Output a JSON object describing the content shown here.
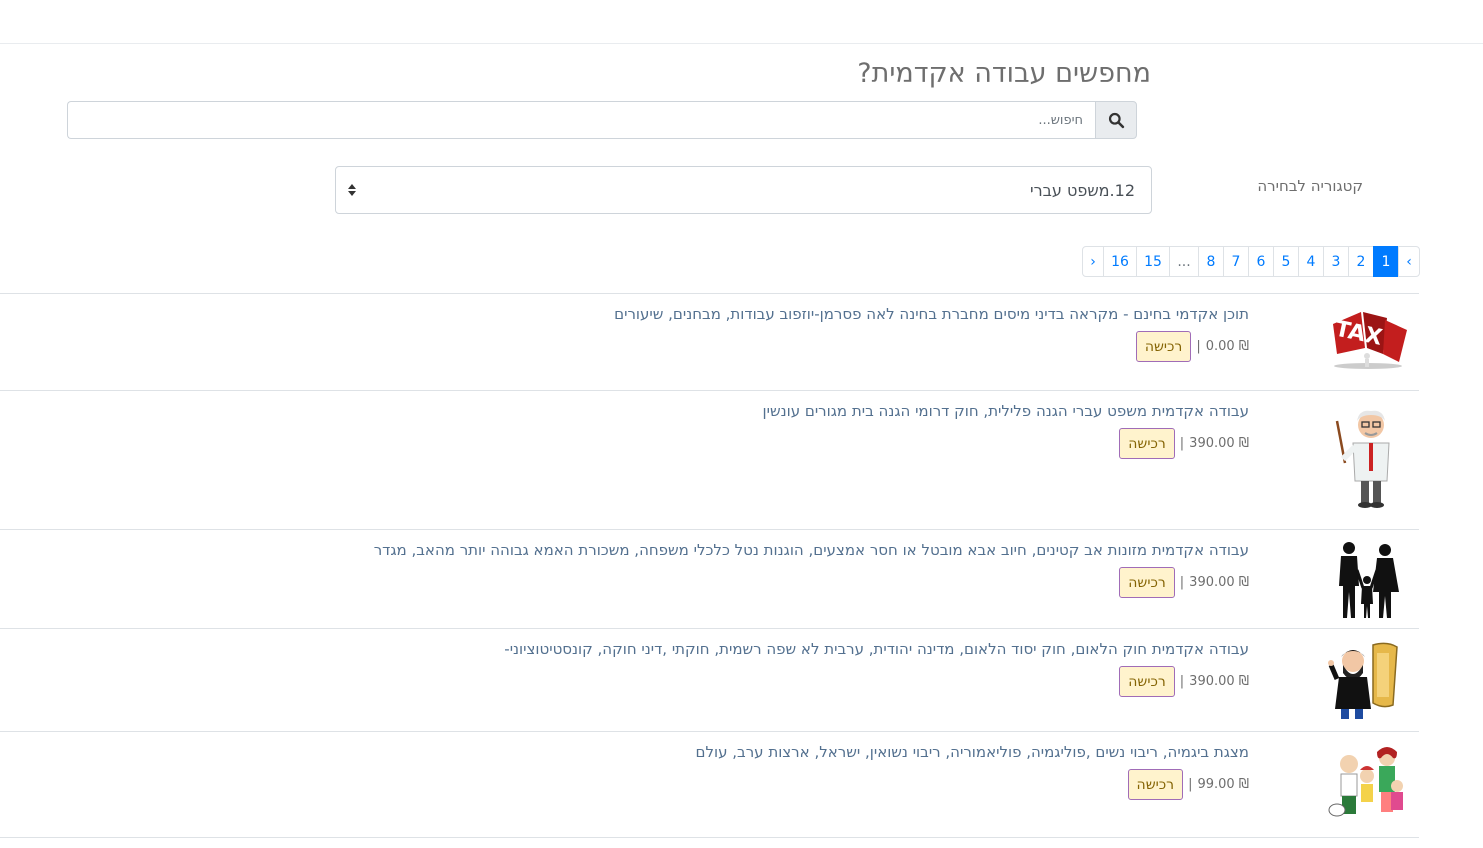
{
  "header": {
    "title": "מחפשים עבודה אקדמית?"
  },
  "search": {
    "placeholder": "חיפוש...",
    "value": "",
    "button_icon": "search-icon"
  },
  "category": {
    "label": "קטגוריה לבחירה",
    "selected": "12.משפט עברי"
  },
  "pagination": {
    "prev": "‹",
    "pages": [
      "1",
      "2",
      "3",
      "4",
      "5",
      "6",
      "7",
      "8"
    ],
    "ellipsis": "...",
    "tail_pages": [
      "15",
      "16"
    ],
    "next": "›",
    "active_page": "1"
  },
  "products": [
    {
      "title": "תוכן אקדמי בחינם - מקראה בדיני מיסים מחברת בחינה לאה פסרמן-יוזפוב עבודות, מבחנים, שיעורים",
      "price": "₪ 0.00",
      "buy_label": "רכישה",
      "image": "tax-icon"
    },
    {
      "title": "עבודה אקדמית משפט עברי הגנה פלילית, חוק דרומי הגנה בית מגורים עונשין",
      "price": "₪ 390.00",
      "buy_label": "רכישה",
      "image": "professor-icon"
    },
    {
      "title": "עבודה אקדמית מזונות אב קטינים, חיוב אבא מובטל או חסר אמצעים, הוגנות נטל כלכלי משפחה, משכורת האמא גבוהה יותר מהאב, מגדר",
      "price": "₪ 390.00",
      "buy_label": "רכישה",
      "image": "family-silhouette-icon"
    },
    {
      "title": "עבודה אקדמית חוק הלאום, חוק יסוד הלאום, מדינה יהודית, ערבית לא שפה רשמית, חוקתי ,דיני חוקה, קונסטיטוציוני-",
      "price": "₪ 390.00",
      "buy_label": "רכישה",
      "image": "rabbi-torah-icon"
    },
    {
      "title": "מצגת ביגמיה, ריבוי נשים ,פוליגמיה, פוליאמוריה, ריבוי נשואין, ישראל, ארצות ערב, עולם",
      "price": "₪ 99.00",
      "buy_label": "רכישה",
      "image": "cartoon-family-icon"
    }
  ],
  "colors": {
    "link": "#007bff",
    "active_page": "#007bff",
    "title_link": "#53708f",
    "buy_bg": "#fff3cd",
    "buy_border": "#a06cb7"
  }
}
